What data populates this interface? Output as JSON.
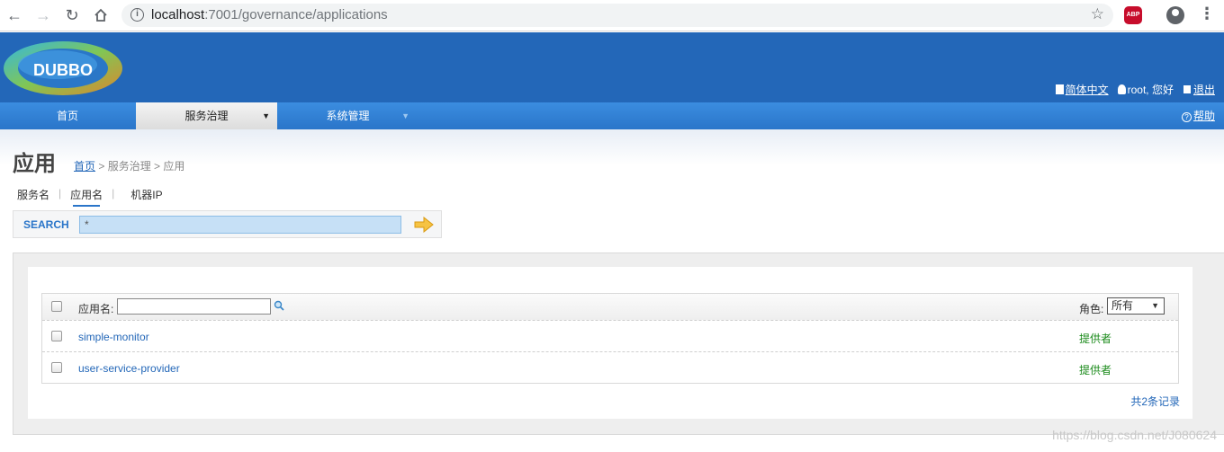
{
  "browser": {
    "url_host": "localhost",
    "url_path": ":7001/governance/applications",
    "abp_label": "ABP"
  },
  "header": {
    "logo_text": "DUBBO",
    "language_link": "简体中文",
    "user_greeting": "root, 您好",
    "logout_link": "退出"
  },
  "menu": {
    "home": "首页",
    "service_governance": "服务治理",
    "system_management": "系统管理",
    "help": "帮助"
  },
  "page": {
    "title": "应用",
    "breadcrumb_home": "首页",
    "breadcrumb_rest": " > 服务治理 > 应用"
  },
  "search": {
    "tabs": [
      "服务名",
      "应用名",
      "机器IP"
    ],
    "active_tab": "应用名",
    "label": "SEARCH",
    "value": "*"
  },
  "table": {
    "filter_label": "应用名:",
    "role_label": "角色:",
    "role_selected": "所有",
    "rows": [
      {
        "name": "simple-monitor",
        "role": "提供者"
      },
      {
        "name": "user-service-provider",
        "role": "提供者"
      }
    ],
    "total": "共2条记录"
  },
  "watermark": "https://blog.csdn.net/J080624",
  "colors": {
    "header_blue": "#2367b8",
    "link_blue": "#2367b8",
    "provider_green": "#1a8a1a"
  }
}
